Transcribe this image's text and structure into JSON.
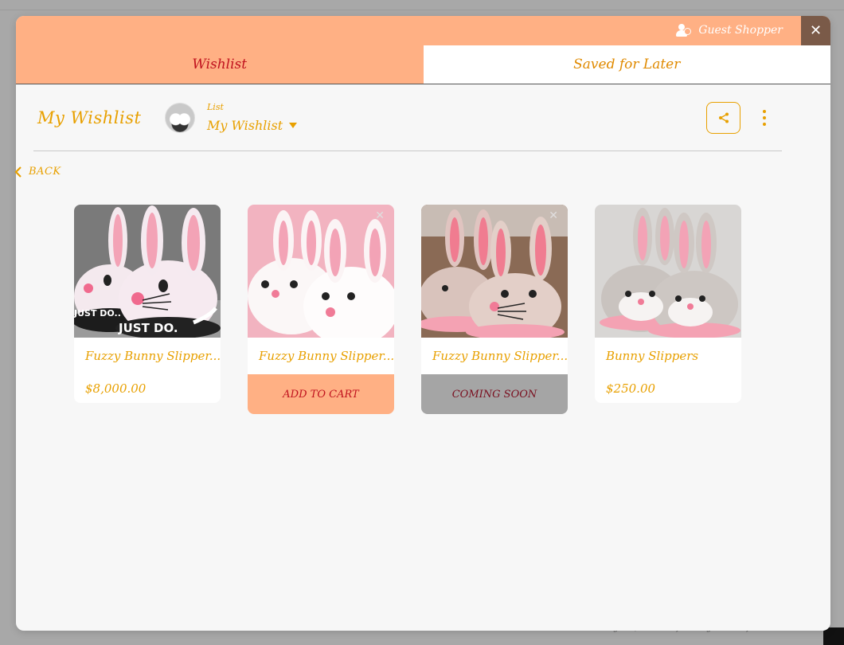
{
  "header": {
    "user_label": "Guest Shopper",
    "close_label": "✕"
  },
  "tabs": [
    {
      "label": "Wishlist",
      "active": true
    },
    {
      "label": "Saved for Later",
      "active": false
    }
  ],
  "wishlist": {
    "title": "My Wishlist",
    "list_label": "List",
    "selected_list": "My Wishlist",
    "back_label": "BACK"
  },
  "products": [
    {
      "name": "Fuzzy Bunny Slipper...",
      "price": "$8,000.00",
      "action": null,
      "image": "bunny-slippers-black-white"
    },
    {
      "name": "Fuzzy Bunny Slipper...",
      "price": null,
      "action": "ADD TO CART",
      "image": "bunny-slippers-white-fluffy"
    },
    {
      "name": "Fuzzy Bunny Slipper...",
      "price": null,
      "action": "COMING SOON",
      "image": "bunny-slippers-tan-floor"
    },
    {
      "name": "Bunny Slippers",
      "price": "$250.00",
      "action": null,
      "image": "bunny-slippers-grey-pink"
    }
  ],
  "backdrop": {
    "partial_text": "More styles, and definitely more food."
  },
  "colors": {
    "accent": "#e8a000",
    "peach": "#ffb084",
    "active_tab_text": "#c0121e",
    "close_bg": "#7a5a48",
    "coming_soon_bg": "#a5a5a5"
  }
}
